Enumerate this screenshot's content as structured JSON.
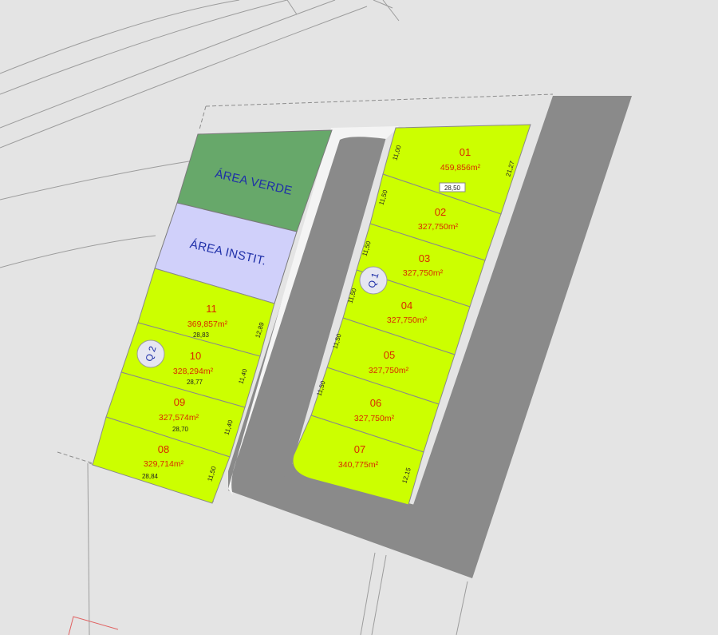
{
  "areas": {
    "verde": "ÁREA VERDE",
    "instit": "ÁREA INSTIT."
  },
  "blocks": {
    "q1": "Q 1",
    "q2": "Q 2"
  },
  "lots": [
    {
      "num": "01",
      "area": "459,856m²"
    },
    {
      "num": "02",
      "area": "327,750m²"
    },
    {
      "num": "03",
      "area": "327,750m²"
    },
    {
      "num": "04",
      "area": "327,750m²"
    },
    {
      "num": "05",
      "area": "327,750m²"
    },
    {
      "num": "06",
      "area": "327,750m²"
    },
    {
      "num": "07",
      "area": "340,775m²"
    },
    {
      "num": "08",
      "area": "329,714m²"
    },
    {
      "num": "09",
      "area": "327,574m²"
    },
    {
      "num": "10",
      "area": "328,294m²"
    },
    {
      "num": "11",
      "area": "369,857m²"
    }
  ],
  "dimensions": {
    "q1_width": "28,50",
    "q1_right": "21,27",
    "q1_bottom_right": "12,15",
    "d_01": "11,00",
    "d_02": "11,50",
    "d_03": "11,50",
    "d_04": "11,50",
    "d_05": "11,50",
    "d_06": "11,50",
    "w_11": "28,83",
    "w_10": "28,77",
    "w_09": "28,70",
    "w_08": "28,84",
    "r_11": "12,89",
    "r_10": "11,40",
    "r_09": "11,40",
    "r_08": "11,50"
  },
  "colors": {
    "lot_fill": "#ccff00",
    "area_verde": "#67a86a",
    "area_instit": "#d0d0fa",
    "road": "#8a8a8a",
    "background": "#e4e4e4",
    "label_red": "#d92a00",
    "label_blue": "#1e2fa8"
  }
}
